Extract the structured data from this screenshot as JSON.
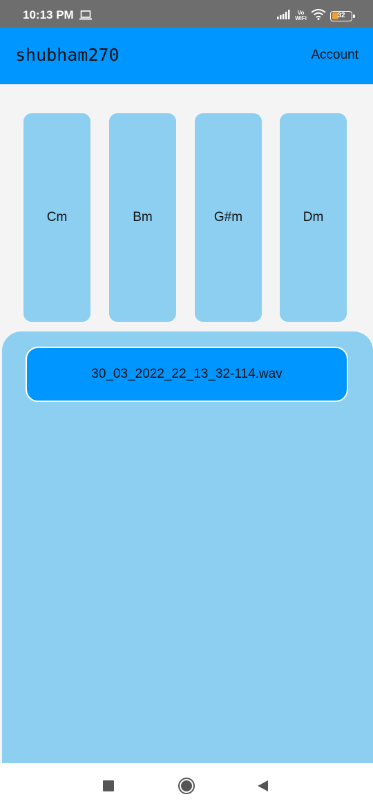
{
  "status_bar": {
    "time": "10:13 PM",
    "vowifi_top": "Vo",
    "vowifi_bottom": "WiFi",
    "battery_level": "32",
    "icons": [
      "laptop-icon",
      "signal-icon",
      "vowifi-icon",
      "wifi-icon",
      "battery-icon"
    ]
  },
  "app_bar": {
    "title": "shubham270",
    "account_label": "Account",
    "color": "#0096ff"
  },
  "chords": [
    {
      "label": "Cm"
    },
    {
      "label": "Bm"
    },
    {
      "label": "G#m"
    },
    {
      "label": "Dm"
    }
  ],
  "recordings": [
    {
      "filename": "30_03_2022_22_13_32-114.wav"
    }
  ],
  "nav_bar": {
    "icons": [
      "recents-icon",
      "home-icon",
      "back-icon"
    ]
  },
  "colors": {
    "accent": "#0096ff",
    "card": "#8ccff0",
    "background": "#f4f4f4"
  }
}
